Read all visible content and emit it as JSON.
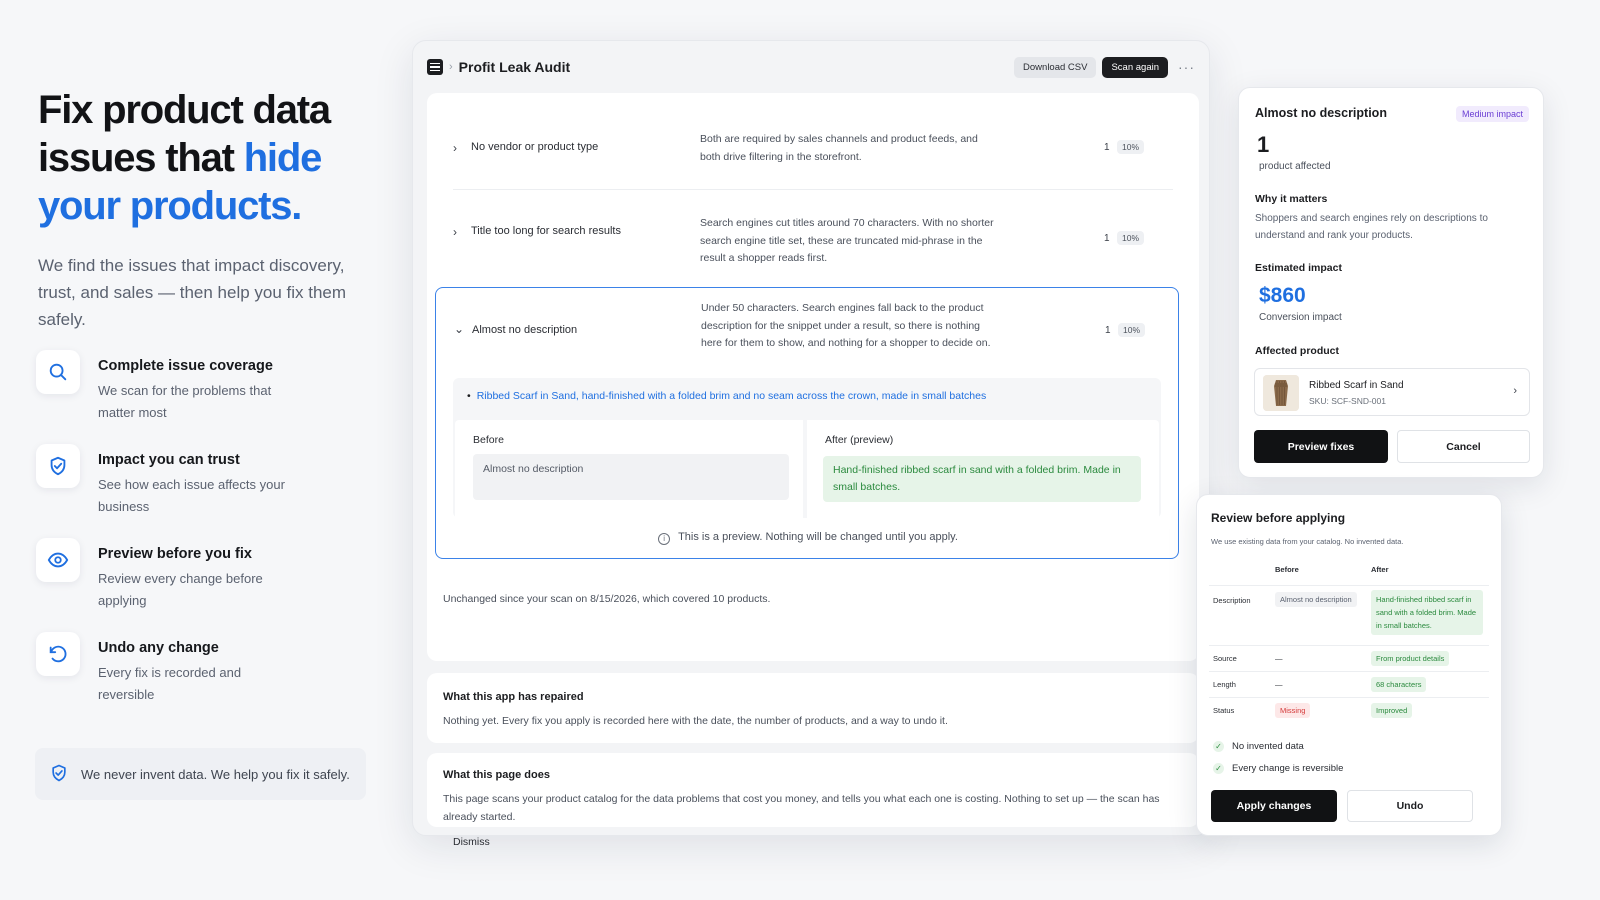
{
  "hero": {
    "headline_part1": "Fix product data issues that",
    "headline_accent": "hide your products.",
    "lede": "We find the issues that impact discovery, trust, and sales — then help you fix them safely."
  },
  "features": [
    {
      "icon": "search-icon",
      "title": "Complete issue coverage",
      "desc": "We scan for the problems that matter most"
    },
    {
      "icon": "shield-check-icon",
      "title": "Impact you can trust",
      "desc": "See how each issue affects your business"
    },
    {
      "icon": "eye-icon",
      "title": "Preview before you fix",
      "desc": "Review every change before applying"
    },
    {
      "icon": "undo-icon",
      "title": "Undo any change",
      "desc": "Every fix is recorded and reversible"
    }
  ],
  "trust_note": "We never invent data. We help you fix it safely.",
  "app": {
    "title": "Profit Leak Audit",
    "download_label": "Download CSV",
    "scan_label": "Scan again",
    "more": "···"
  },
  "issues": [
    {
      "chevron": "›",
      "name": "No vendor or product type",
      "desc": "Both are required by sales channels and product feeds, and both drive filtering in the storefront.",
      "count": "1",
      "pct": "10%"
    },
    {
      "chevron": "›",
      "name": "Title too long for search results",
      "desc": "Search engines cut titles around 70 characters. With no shorter search engine title set, these are truncated mid-phrase in the result a shopper reads first.",
      "count": "1",
      "pct": "10%"
    },
    {
      "chevron": "⌄",
      "name": "Almost no description",
      "desc": "Under 50 characters. Search engines fall back to the product description for the snippet under a result, so there is nothing here for them to show, and nothing for a shopper to decide on.",
      "count": "1",
      "pct": "10%"
    }
  ],
  "expanded": {
    "product_link": "Ribbed Scarf in Sand, hand-finished with a folded brim and no seam across the crown, made in small batches",
    "before_label": "Before",
    "before_value": "Almost no description",
    "after_label": "After (preview)",
    "after_value": "Hand-finished ribbed scarf in sand with a folded brim. Made in small batches.",
    "preview_note": "This is a preview. Nothing will be changed until you apply."
  },
  "unchanged": "Unchanged since your scan on 8/15/2026, which covered 10 products.",
  "repaired": {
    "title": "What this app has repaired",
    "desc": "Nothing yet. Every fix you apply is recorded here with the date, the number of products, and a way to undo it."
  },
  "page_does": {
    "title": "What this page does",
    "desc": "This page scans your product catalog for the data problems that cost you money, and tells you what each one is costing. Nothing to set up — the scan has already started.",
    "dismiss": "Dismiss"
  },
  "detail_card": {
    "title": "Almost no description",
    "badge": "Medium impact",
    "count": "1",
    "count_label": "product affected",
    "why_title": "Why it matters",
    "why_desc": "Shoppers and search engines rely on descriptions to understand and rank your products.",
    "impact_title": "Estimated impact",
    "impact_value": "$860",
    "impact_label": "Conversion impact",
    "affected_title": "Affected product",
    "product_name": "Ribbed Scarf in Sand",
    "product_sku": "SKU: SCF-SND-001",
    "preview_btn": "Preview fixes",
    "cancel_btn": "Cancel"
  },
  "review_card": {
    "title": "Review before applying",
    "subtitle": "We use existing data from your catalog. No invented data.",
    "col_before": "Before",
    "col_after": "After",
    "rows": [
      {
        "label": "Description",
        "before": "Almost no description",
        "after": "Hand-finished ribbed scarf in sand with a folded brim. Made in small batches."
      },
      {
        "label": "Source",
        "before": "—",
        "after": "From product details"
      },
      {
        "label": "Length",
        "before": "—",
        "after": "68 characters"
      },
      {
        "label": "Status",
        "before": "Missing",
        "after": "Improved"
      }
    ],
    "check1": "No invented data",
    "check2": "Every change is reversible",
    "apply_btn": "Apply changes",
    "undo_btn": "Undo"
  },
  "colors": {
    "accent": "#1f6fe0",
    "success": "#2b8a3e",
    "danger": "#d43a3a",
    "badge_purple": "#6b3fd4",
    "dark_button": "#111214"
  }
}
